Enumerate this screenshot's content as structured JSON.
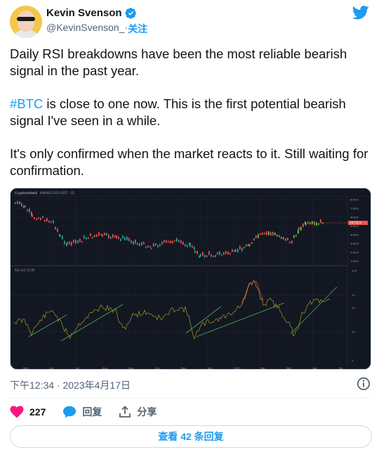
{
  "author": {
    "name": "Kevin Svenson",
    "handle": "@KevinSvenson_",
    "separator": " · ",
    "follow_label": "关注"
  },
  "tweet": {
    "paragraph_1": "Daily RSI breakdowns have been the most reliable bearish signal in the past year.",
    "hashtag": "#BTC",
    "paragraph_2_rest": " is close to one now. This is the first potential bearish signal I've seen in a while.",
    "paragraph_3": "It's only confirmed when the market reacts to it. Still waiting for confirmation."
  },
  "media": {
    "chart_brand": "Cryptosdotwik",
    "chart_info": "BINANCE:BTC/USDT · 1D",
    "price_ticks": [
      "80000",
      "70000",
      "60000",
      "50000",
      "40000",
      "30000",
      "20000",
      "10000"
    ],
    "price_tag": "29774.0",
    "rsi_label": "RSI (14) 55.87",
    "rsi_ticks": [
      "100",
      "70",
      "50",
      "30",
      "0"
    ],
    "month_labels": [
      "May",
      "Jun",
      "Jul",
      "Aug",
      "Sep",
      "Oct",
      "Nov",
      "Dec",
      "2023",
      "Feb",
      "Mar",
      "Apr",
      "Ma"
    ]
  },
  "meta": {
    "timestamp": "下午12:34 · 2023年4月17日"
  },
  "actions": {
    "likes_count": "227",
    "reply_label": "回复",
    "share_label": "分享"
  },
  "replies_button": "查看 42 条回复",
  "colors": {
    "accent": "#1d9bf0",
    "like": "#f91880",
    "chart_bg": "#131722",
    "candle_up": "#26a69a",
    "candle_up_alt": "#5bd34b",
    "candle_down": "#ef5350",
    "rsi_line": "#a39a1f",
    "trend_line": "#4caf50"
  }
}
